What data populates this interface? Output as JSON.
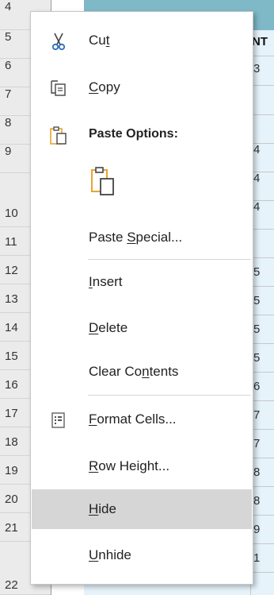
{
  "sheet": {
    "row_numbers": [
      "4",
      "5",
      "6",
      "7",
      "8",
      "9",
      "10",
      "11",
      "12",
      "13",
      "14",
      "15",
      "16",
      "17",
      "18",
      "19",
      "20",
      "21",
      "22"
    ],
    "column_header_partial": "NT",
    "column_values_partial": [
      "3",
      "",
      "4",
      "4",
      "4",
      "",
      "5",
      "5",
      "5",
      "5",
      "6",
      "7",
      "7",
      "8",
      "8",
      "9",
      "1"
    ]
  },
  "context_menu": {
    "items": [
      {
        "name": "cut",
        "label_before": "Cu",
        "mnemonic": "t",
        "label_after": "",
        "icon": "scissors-icon",
        "bold": false
      },
      {
        "name": "copy",
        "label_before": "",
        "mnemonic": "C",
        "label_after": "opy",
        "icon": "copy-icon",
        "bold": false
      },
      {
        "name": "paste-options",
        "label_before": "Paste Options:",
        "mnemonic": "",
        "label_after": "",
        "icon": "clipboard-icon",
        "bold": true
      },
      {
        "name": "paste-special",
        "label_before": "Paste ",
        "mnemonic": "S",
        "label_after": "pecial...",
        "icon": "",
        "bold": false
      },
      {
        "name": "insert",
        "label_before": "",
        "mnemonic": "I",
        "label_after": "nsert",
        "icon": "",
        "bold": false
      },
      {
        "name": "delete",
        "label_before": "",
        "mnemonic": "D",
        "label_after": "elete",
        "icon": "",
        "bold": false
      },
      {
        "name": "clear-contents",
        "label_before": "Clear Co",
        "mnemonic": "n",
        "label_after": "tents",
        "icon": "",
        "bold": false
      },
      {
        "name": "format-cells",
        "label_before": "",
        "mnemonic": "F",
        "label_after": "ormat Cells...",
        "icon": "format-cells-icon",
        "bold": false
      },
      {
        "name": "row-height",
        "label_before": "",
        "mnemonic": "R",
        "label_after": "ow Height...",
        "icon": "",
        "bold": false
      },
      {
        "name": "hide",
        "label_before": "",
        "mnemonic": "H",
        "label_after": "ide",
        "icon": "",
        "bold": false,
        "highlighted": true
      },
      {
        "name": "unhide",
        "label_before": "",
        "mnemonic": "U",
        "label_after": "nhide",
        "icon": "",
        "bold": false
      }
    ],
    "paste_option_button_icon": "clipboard-paste-icon",
    "colors": {
      "highlight": "#d6d6d6",
      "icon_accent": "#e8a430",
      "icon_blue": "#2b6fb5"
    }
  }
}
